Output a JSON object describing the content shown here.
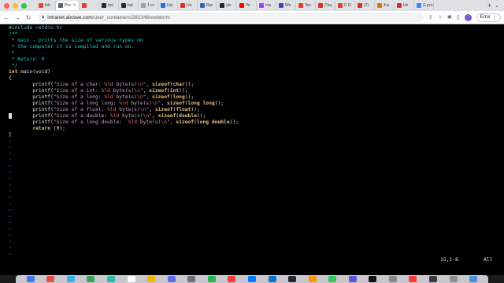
{
  "tabs": [
    {
      "label": "Inb",
      "favicon_color": "#ea4335"
    },
    {
      "label": "Pro",
      "favicon_color": "#5f6368",
      "active": true
    },
    {
      "label": "",
      "favicon_color": "#e53935"
    },
    {
      "label": "hol",
      "favicon_color": "#24292f"
    },
    {
      "label": "hol",
      "favicon_color": "#24292f"
    },
    {
      "label": "1 cc",
      "favicon_color": "#9e9e9e"
    },
    {
      "label": "Usi",
      "favicon_color": "#1a73e8"
    },
    {
      "label": "Un",
      "favicon_color": "#d93025"
    },
    {
      "label": "Rur",
      "favicon_color": "#2b6cb0"
    },
    {
      "label": "alx",
      "favicon_color": "#24292f"
    },
    {
      "label": "Yo",
      "favicon_color": "#ff0000"
    },
    {
      "label": "ma",
      "favicon_color": "#a142f4"
    },
    {
      "label": "Wo",
      "favicon_color": "#3949ab"
    },
    {
      "label": "Tec",
      "favicon_color": "#e53935"
    },
    {
      "label": "Cha",
      "favicon_color": "#d93025"
    },
    {
      "label": "C Fi",
      "favicon_color": "#e53935"
    },
    {
      "label": "(7)",
      "favicon_color": "#d93025"
    },
    {
      "label": "4-p",
      "favicon_color": "#e8710a"
    },
    {
      "label": "Un",
      "favicon_color": "#d93025"
    },
    {
      "label": "G pro",
      "favicon_color": "#4285f4"
    }
  ],
  "toolbar": {
    "url_host": "intranet.alxswe.com",
    "url_path": "/user_containers/282346/webterm",
    "error_label": "Error"
  },
  "terminal": {
    "lines": [
      {
        "tokens": [
          [
            "pre",
            "#include <stdio.h>"
          ]
        ]
      },
      {
        "tokens": [
          [
            "com",
            "/**"
          ]
        ]
      },
      {
        "tokens": [
          [
            "com",
            " * main - prints the size of various types on"
          ]
        ]
      },
      {
        "tokens": [
          [
            "com",
            " * the computer it is compiled and run on."
          ]
        ]
      },
      {
        "tokens": [
          [
            "com",
            " *"
          ]
        ]
      },
      {
        "tokens": [
          [
            "com",
            " * Return: 0"
          ]
        ]
      },
      {
        "tokens": [
          [
            "com",
            " */"
          ]
        ]
      },
      {
        "tokens": [
          [
            "kw",
            "int"
          ],
          [
            "plain",
            " main(void)"
          ]
        ]
      },
      {
        "tokens": [
          [
            "plain",
            "{"
          ]
        ]
      },
      {
        "tokens": [
          [
            "plain",
            "        printf("
          ],
          [
            "str",
            "\"Size of a char: "
          ],
          [
            "fmt",
            "%ld"
          ],
          [
            "str",
            " byte(s)"
          ],
          [
            "fmt",
            "\\n"
          ],
          [
            "str",
            "\""
          ],
          [
            "plain",
            ", "
          ],
          [
            "kw",
            "sizeof"
          ],
          [
            "plain",
            "("
          ],
          [
            "kw",
            "char"
          ],
          [
            "plain",
            "));"
          ]
        ]
      },
      {
        "tokens": [
          [
            "plain",
            "        printf("
          ],
          [
            "str",
            "\"Size of a int: "
          ],
          [
            "fmt",
            "%ld"
          ],
          [
            "str",
            " byte(s)"
          ],
          [
            "fmt",
            "\\n"
          ],
          [
            "str",
            "\""
          ],
          [
            "plain",
            ", "
          ],
          [
            "kw",
            "sizeof"
          ],
          [
            "plain",
            "("
          ],
          [
            "kw",
            "int"
          ],
          [
            "plain",
            "));"
          ]
        ]
      },
      {
        "tokens": [
          [
            "plain",
            "        printf("
          ],
          [
            "str",
            "\"Size of a long: "
          ],
          [
            "fmt",
            "%ld"
          ],
          [
            "str",
            " byte(s)"
          ],
          [
            "fmt",
            "\\n"
          ],
          [
            "str",
            "\""
          ],
          [
            "plain",
            ", "
          ],
          [
            "kw",
            "sizeof"
          ],
          [
            "plain",
            "("
          ],
          [
            "kw",
            "long"
          ],
          [
            "plain",
            "));"
          ]
        ]
      },
      {
        "tokens": [
          [
            "plain",
            "        printf("
          ],
          [
            "str",
            "\"Size of a long long: "
          ],
          [
            "fmt",
            "%ld"
          ],
          [
            "str",
            " byte(s)"
          ],
          [
            "fmt",
            "\\n"
          ],
          [
            "str",
            "\""
          ],
          [
            "plain",
            ", "
          ],
          [
            "kw",
            "sizeof"
          ],
          [
            "plain",
            "("
          ],
          [
            "kw",
            "long long"
          ],
          [
            "plain",
            "));"
          ]
        ]
      },
      {
        "tokens": [
          [
            "plain",
            "        printf("
          ],
          [
            "str",
            "\"Size of a float: "
          ],
          [
            "fmt",
            "%ld"
          ],
          [
            "str",
            " byte(s)"
          ],
          [
            "fmt",
            "\\n"
          ],
          [
            "str",
            "\""
          ],
          [
            "plain",
            ", "
          ],
          [
            "kw",
            "sizeof"
          ],
          [
            "plain",
            "("
          ],
          [
            "kw",
            "float"
          ],
          [
            "plain",
            "));"
          ]
        ]
      },
      {
        "tokens": [
          [
            "cursor",
            " "
          ],
          [
            "plain",
            "       printf("
          ],
          [
            "str",
            "\"Size of a double: "
          ],
          [
            "fmt",
            "%ld"
          ],
          [
            "str",
            " byte(s)"
          ],
          [
            "fmt",
            "\\n"
          ],
          [
            "str",
            "\""
          ],
          [
            "plain",
            ", "
          ],
          [
            "kw",
            "sizeof"
          ],
          [
            "plain",
            "("
          ],
          [
            "kw",
            "double"
          ],
          [
            "plain",
            "));"
          ]
        ]
      },
      {
        "tokens": [
          [
            "plain",
            "        printf("
          ],
          [
            "str",
            "\"Size of a long double:  "
          ],
          [
            "fmt",
            "%ld"
          ],
          [
            "str",
            " byte(s)"
          ],
          [
            "fmt",
            "\\n"
          ],
          [
            "str",
            "\""
          ],
          [
            "plain",
            ", "
          ],
          [
            "kw",
            "sizeof"
          ],
          [
            "plain",
            "("
          ],
          [
            "kw",
            "long double"
          ],
          [
            "plain",
            "));"
          ]
        ]
      },
      {
        "tokens": [
          [
            "plain",
            "        "
          ],
          [
            "kw",
            "return"
          ],
          [
            "plain",
            " (0);"
          ]
        ]
      },
      {
        "tokens": [
          [
            "plain",
            "}"
          ]
        ]
      }
    ],
    "empty_marker": "~",
    "status_position": "15,1-8",
    "status_scroll": "All"
  },
  "dock": {
    "apps": [
      "#3d7be8",
      "#e94f3c",
      "#2fb5ea",
      "#34a853",
      "#2bbbad",
      "#ffffff",
      "#f4b400",
      "#5b6cf0",
      "#6e6e73",
      "#1db954",
      "#ea4335",
      "#007aff",
      "#0078d4",
      "#24292f",
      "#ff9500",
      "#34c759",
      "#5856d6",
      "#111111",
      "#888888",
      "#ff3b30",
      "#3a3a3c",
      "#8e8e93",
      "#4a90e2"
    ]
  }
}
